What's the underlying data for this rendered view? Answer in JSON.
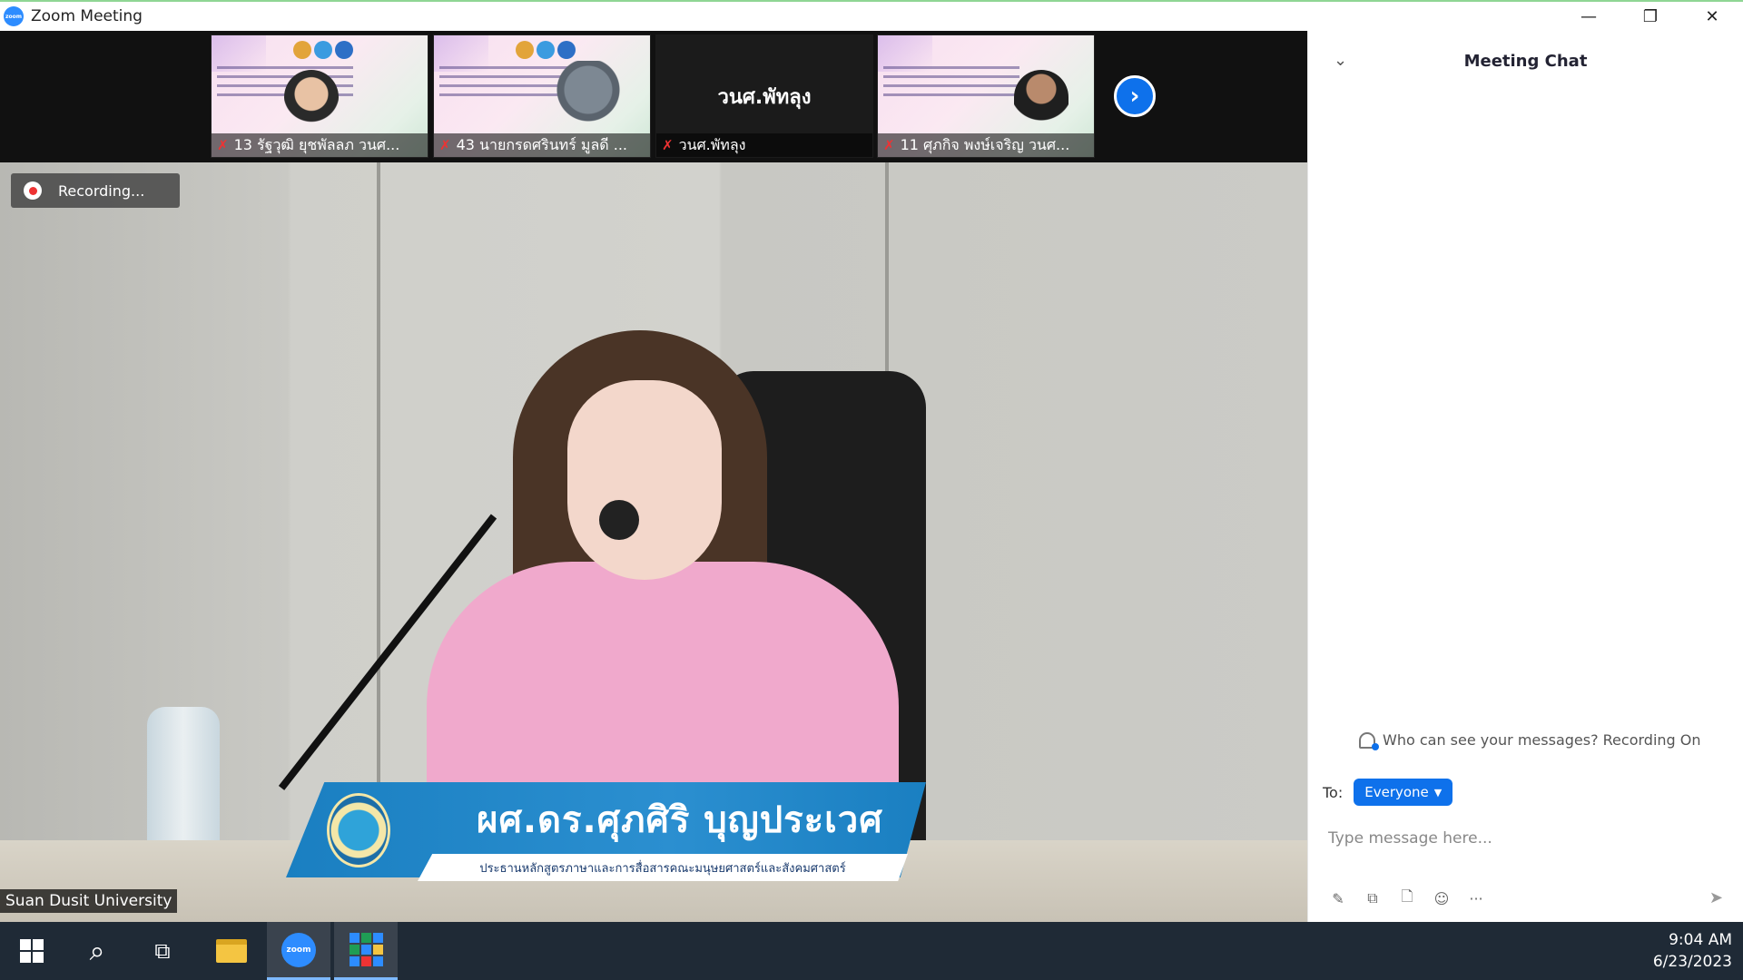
{
  "window": {
    "title": "Zoom Meeting",
    "app_logo_text": "zoom",
    "controls": {
      "minimize": "—",
      "restore": "❐",
      "close": "✕"
    }
  },
  "thumbnails": [
    {
      "name": "13 รัฐวุฒิ ยุชพัลลภ วนศ...",
      "mic": "muted",
      "kind": "slide"
    },
    {
      "name": "43 นายกรดศรินทร์ มูลดี ...",
      "mic": "muted",
      "kind": "slide"
    },
    {
      "name": "วนศ.พัทลุง",
      "center_name": "วนศ.พัทลุง",
      "mic": "muted",
      "kind": "dark"
    },
    {
      "name": "11 ศุภกิจ พงษ์เจริญ วนศ...",
      "mic": "muted",
      "kind": "slide"
    }
  ],
  "strip_next_icon": "›",
  "recording": {
    "label": "Recording..."
  },
  "speaker_banner": {
    "name": "ผศ.ดร.ศุภศิริ บุญประเวศ",
    "subtitle": "ประธานหลักสูตรภาษาและการสื่อสารคณะมนุษยศาสตร์และสังคมศาสตร์"
  },
  "video_label": "Suan Dusit University",
  "chat": {
    "title": "Meeting Chat",
    "collapse_icon": "⌄",
    "visibility_notice": "Who can see your messages? Recording On",
    "to_label": "To:",
    "to_value": "Everyone",
    "input_placeholder": "Type message here...",
    "tools": [
      "✎",
      "⧉",
      "🗋",
      "☺",
      "···"
    ],
    "send_icon": "➤"
  },
  "taskbar": {
    "time": "9:04 AM",
    "date": "6/23/2023",
    "zoom_text": "zoom"
  },
  "colors": {
    "accent": "#0e71eb",
    "taskbar": "#1f2a36",
    "muted_mic": "#e33333"
  }
}
